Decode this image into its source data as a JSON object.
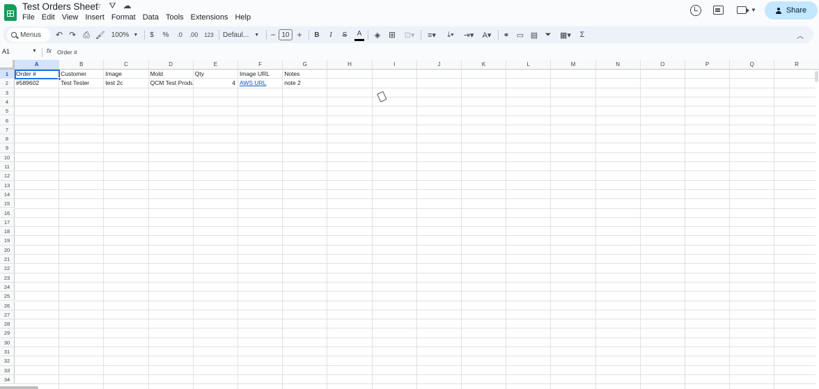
{
  "app": {
    "title": "Test Orders Sheet",
    "menu": [
      "File",
      "Edit",
      "View",
      "Insert",
      "Format",
      "Data",
      "Tools",
      "Extensions",
      "Help"
    ],
    "share_label": "Share",
    "brand_color": "#0f9d58",
    "share_color": "#c2e7ff",
    "title_icons": [
      "star-icon",
      "drive-move-icon",
      "cloud-saved-icon"
    ],
    "right_icons": [
      "version-history-icon",
      "comments-icon",
      "meet-icon"
    ]
  },
  "toolbar": {
    "search_label": "Menus",
    "zoom": "100%",
    "currency": "$",
    "percent": "%",
    "decrease_decimal": ".0",
    "increase_decimal": ".00",
    "more_formats": "123",
    "font_family": "Defaul...",
    "font_size": "10",
    "decrease_font": "−",
    "increase_font": "+",
    "bold": "B",
    "italic": "I",
    "strikethrough": "S",
    "text_color": "A",
    "sum": "Σ",
    "icons": [
      "undo-icon",
      "redo-icon",
      "print-icon",
      "paint-format-icon",
      "fill-color-icon",
      "borders-icon",
      "merge-icon",
      "align-icon",
      "valign-icon",
      "wrap-icon",
      "rotate-icon",
      "link-icon",
      "comment-icon",
      "chart-icon",
      "filter-icon",
      "filter-views-icon",
      "collapse-icon"
    ]
  },
  "formula_bar": {
    "name_box": "A1",
    "fx": "fx",
    "value": "Order #"
  },
  "columns": [
    "A",
    "B",
    "C",
    "D",
    "E",
    "F",
    "G",
    "H",
    "I",
    "J",
    "K",
    "L",
    "M",
    "N",
    "O",
    "P",
    "Q",
    "R"
  ],
  "rows": [
    "1",
    "2",
    "3",
    "4",
    "5",
    "6",
    "7",
    "8",
    "9",
    "10",
    "11",
    "12",
    "13",
    "14",
    "15",
    "16",
    "17",
    "18",
    "19",
    "20",
    "21",
    "22",
    "23",
    "24",
    "25",
    "26",
    "27",
    "28",
    "29",
    "30",
    "31",
    "32",
    "33",
    "34"
  ],
  "cells": {
    "r1": [
      "Order #",
      "Customer",
      "Image",
      "Mold",
      "Qty",
      "Image URL",
      "Notes"
    ],
    "r2": [
      "#589602",
      "Test Tester",
      "test 2c",
      "QCM Test Produ",
      "4",
      "AWS URL",
      "note 2"
    ]
  },
  "link_color": "#1155cc",
  "selection_color": "#1a73e8"
}
